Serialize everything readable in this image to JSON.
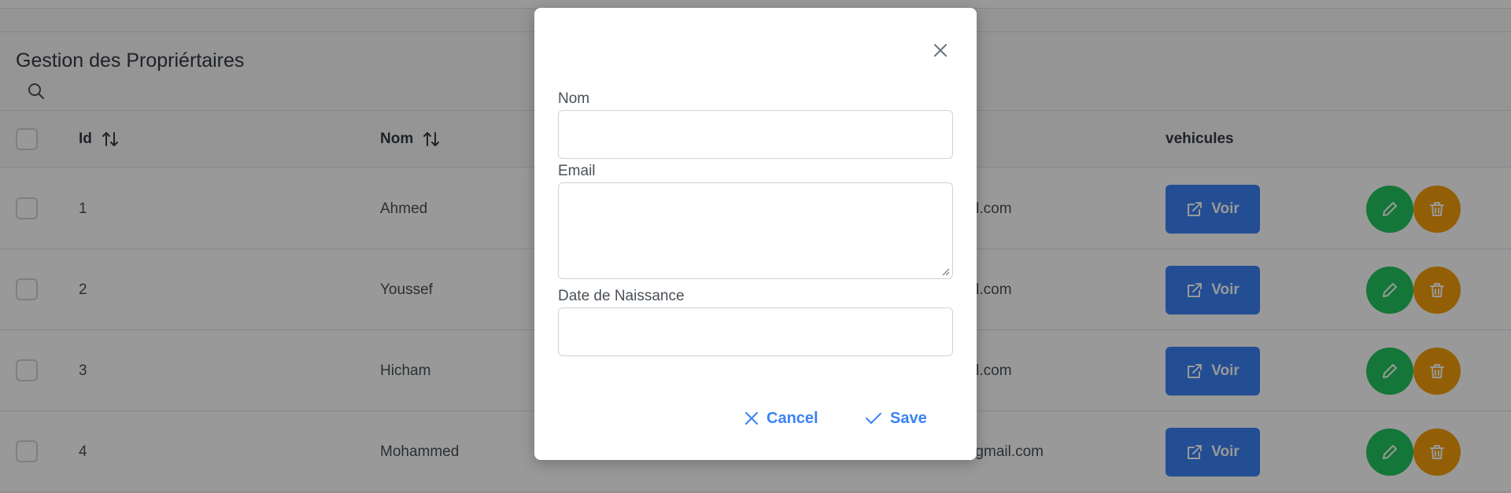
{
  "page": {
    "title": "Gestion des Propriértaires"
  },
  "table": {
    "headers": {
      "id": "Id",
      "nom": "Nom",
      "vehicules": "vehicules"
    },
    "rows": [
      {
        "id": "1",
        "nom": "Ahmed",
        "email": "gmail.com",
        "action_label": "Voir"
      },
      {
        "id": "2",
        "nom": "Youssef",
        "email": "gmail.com",
        "action_label": "Voir"
      },
      {
        "id": "3",
        "nom": "Hicham",
        "email": "gmail.com",
        "action_label": "Voir"
      },
      {
        "id": "4",
        "nom": "Mohammed",
        "email": "ed@gmail.com",
        "action_label": "Voir"
      }
    ]
  },
  "dialog": {
    "fields": {
      "nom_label": "Nom",
      "email_label": "Email",
      "date_label": "Date de Naissance",
      "nom_value": "",
      "email_value": "",
      "date_value": ""
    },
    "cancel_label": "Cancel",
    "save_label": "Save"
  },
  "colors": {
    "primary": "#3b82f6",
    "success": "#22c55e",
    "warning": "#f59e0b"
  },
  "icons": {
    "search": "search-icon",
    "sort": "sort-icon",
    "external": "external-link-icon",
    "edit": "pencil-icon",
    "delete": "trash-icon",
    "close": "close-icon",
    "cancel": "x-icon",
    "save": "check-icon"
  }
}
